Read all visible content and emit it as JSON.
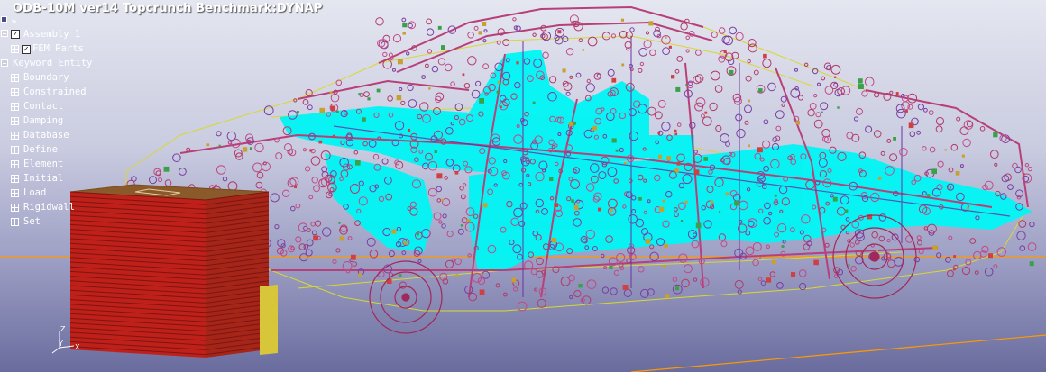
{
  "window": {
    "title": "ODB-10M ver14 Topcrunch Benchmark:DYNAP"
  },
  "tree": {
    "toolbar_icon": "double-chevron-right-icon",
    "assembly": {
      "label": "Assembly 1",
      "checked": true
    },
    "fem_parts": {
      "label": "FEM Parts",
      "checked": true
    },
    "keyword_entity": {
      "label": "Keyword Entity"
    },
    "keywords": [
      {
        "label": "Boundary"
      },
      {
        "label": "Constrained"
      },
      {
        "label": "Contact"
      },
      {
        "label": "Damping"
      },
      {
        "label": "Database"
      },
      {
        "label": "Define"
      },
      {
        "label": "Element"
      },
      {
        "label": "Initial"
      },
      {
        "label": "Load"
      },
      {
        "label": "Rigidwall"
      },
      {
        "label": "Set"
      }
    ]
  },
  "axes": {
    "x": "X",
    "y": "Y",
    "z": "Z"
  },
  "colors": {
    "background_top": "#e4e6f0",
    "background_bottom": "#6a6c9e",
    "mesh_cyan": "#00f5f5",
    "weld_magenta": "#b8407a",
    "barrier_brown": "#8b5a2b",
    "barrier_red": "#c0201a",
    "floor_orange": "#ff9900"
  }
}
